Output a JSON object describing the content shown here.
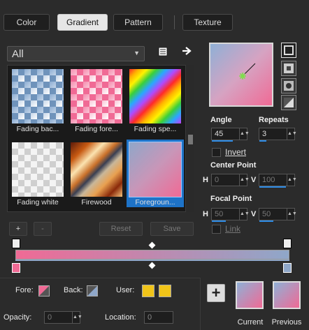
{
  "tabs": [
    {
      "label": "Color",
      "active": false
    },
    {
      "label": "Gradient",
      "active": true
    },
    {
      "label": "Pattern",
      "active": false
    },
    {
      "label": "Texture",
      "active": false
    }
  ],
  "preset_filter": {
    "value": "All"
  },
  "swatches": [
    {
      "label": "Fading bac...",
      "style": "fading-blue",
      "selected": false
    },
    {
      "label": "Fading fore...",
      "style": "fading-pink",
      "selected": false
    },
    {
      "label": "Fading spe...",
      "style": "spectrum",
      "selected": false
    },
    {
      "label": "Fading white",
      "style": "fading-white",
      "selected": false
    },
    {
      "label": "Firewood",
      "style": "firewood",
      "selected": false
    },
    {
      "label": "Foregroun...",
      "style": "fg-bg",
      "selected": true
    }
  ],
  "buttons": {
    "add": "+",
    "remove": "-",
    "reset": "Reset",
    "save": "Save"
  },
  "settings": {
    "angle_label": "Angle",
    "angle_value": "45",
    "repeats_label": "Repeats",
    "repeats_value": "3",
    "invert_label": "Invert",
    "center_point_label": "Center Point",
    "center_h_label": "H",
    "center_h_value": "0",
    "center_v_label": "V",
    "center_v_value": "100",
    "focal_point_label": "Focal Point",
    "focal_h_label": "H",
    "focal_h_value": "50",
    "focal_v_label": "V",
    "focal_v_value": "50",
    "link_label": "Link"
  },
  "gradient": {
    "start_color": "#f06a95",
    "end_color": "#8fa7c9"
  },
  "bottom": {
    "fore_label": "Fore:",
    "back_label": "Back:",
    "user_label": "User:",
    "opacity_label": "Opacity:",
    "opacity_value": "0",
    "location_label": "Location:",
    "location_value": "0",
    "current_label": "Current",
    "previous_label": "Previous",
    "user_color": "#f0c419"
  }
}
